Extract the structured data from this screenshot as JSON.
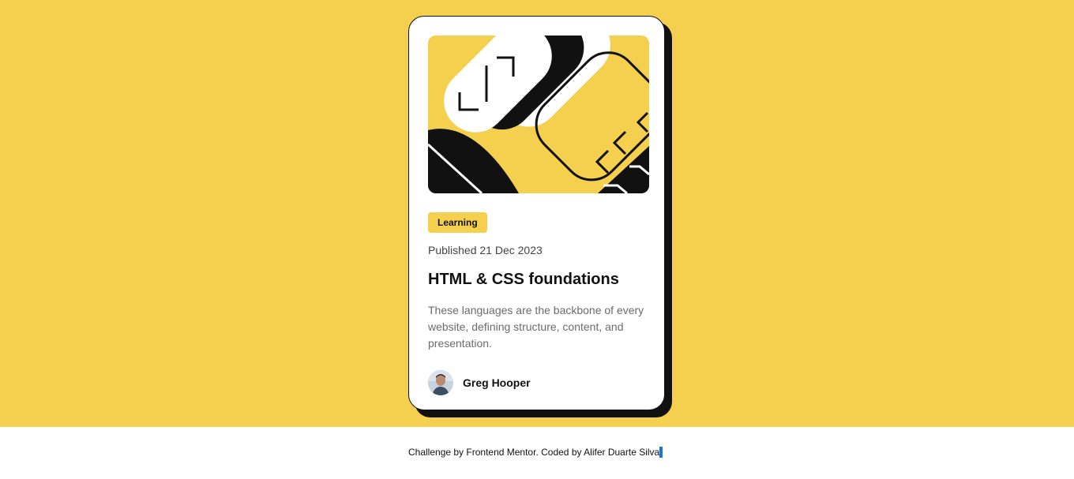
{
  "card": {
    "hero_image": "illustration-article",
    "category": "Learning",
    "published": "Published 21 Dec 2023",
    "title": "HTML & CSS foundations",
    "description": "These languages are the backbone of every website, defining structure, content, and presentation.",
    "author": {
      "name": "Greg Hooper",
      "avatar": "avatar-icon"
    }
  },
  "attribution": {
    "prefix": "Challenge by ",
    "frontend_mentor": "Frontend Mentor",
    "middle": ". Coded by ",
    "author": "Alifer Duarte Silva",
    "suffix": "."
  },
  "colors": {
    "background": "#f4d04e",
    "card": "#ffffff",
    "ink": "#111111",
    "muted": "#6b6b6b",
    "accent": "#f4d04e"
  }
}
